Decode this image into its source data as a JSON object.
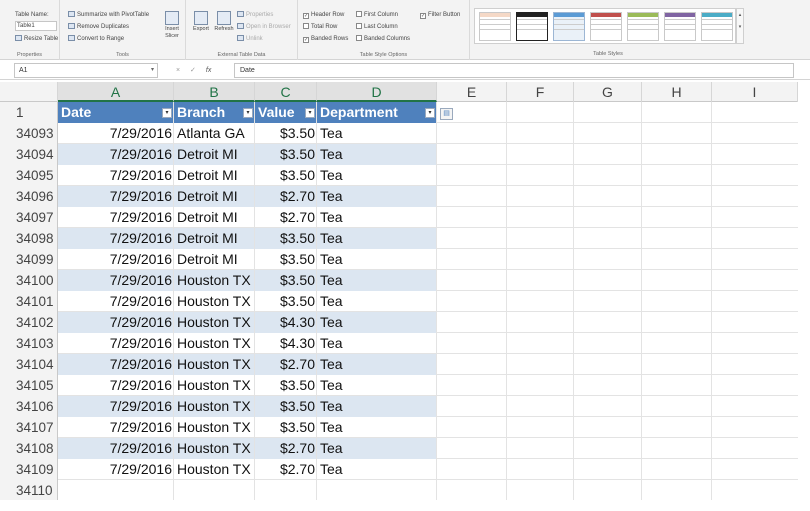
{
  "ribbon": {
    "properties": {
      "table_name_label": "Table Name:",
      "table_name_value": "Table1",
      "resize_label": "Resize Table",
      "group_label": "Properties"
    },
    "tools": {
      "summarize_label": "Summarize with PivotTable",
      "remove_duplicates_label": "Remove Duplicates",
      "convert_label": "Convert to Range",
      "insert_slicer_label": "Insert Slicer",
      "group_label": "Tools"
    },
    "external": {
      "export_label": "Export",
      "refresh_label": "Refresh",
      "properties_label": "Properties",
      "open_browser_label": "Open in Browser",
      "unlink_label": "Unlink",
      "group_label": "External Table Data"
    },
    "style_options": {
      "header_row": "Header Row",
      "total_row": "Total Row",
      "banded_rows": "Banded Rows",
      "first_column": "First Column",
      "last_column": "Last Column",
      "banded_columns": "Banded Columns",
      "filter_button": "Filter Button",
      "group_label": "Table Style Options"
    },
    "table_styles": {
      "group_label": "Table Styles",
      "swatch_colors": [
        "#f5d9c7",
        "#222222",
        "#5b9bd5",
        "#c0504d",
        "#9bbb59",
        "#8064a2",
        "#4bacc6"
      ]
    }
  },
  "formula_bar": {
    "name_box": "A1",
    "cancel_icon": "×",
    "enter_icon": "✓",
    "fx_label": "fx",
    "formula": "Date"
  },
  "columns": [
    "A",
    "B",
    "C",
    "D",
    "E",
    "F",
    "G",
    "H",
    "I"
  ],
  "table": {
    "header_row_number": "1",
    "headers": [
      "Date",
      "Branch",
      "Value",
      "Department"
    ],
    "filter_icon": "▾",
    "rows": [
      {
        "n": "34093",
        "date": "7/29/2016",
        "branch": "Atlanta GA",
        "value": "$3.50",
        "dept": "Tea"
      },
      {
        "n": "34094",
        "date": "7/29/2016",
        "branch": "Detroit MI",
        "value": "$3.50",
        "dept": "Tea"
      },
      {
        "n": "34095",
        "date": "7/29/2016",
        "branch": "Detroit MI",
        "value": "$3.50",
        "dept": "Tea"
      },
      {
        "n": "34096",
        "date": "7/29/2016",
        "branch": "Detroit MI",
        "value": "$2.70",
        "dept": "Tea"
      },
      {
        "n": "34097",
        "date": "7/29/2016",
        "branch": "Detroit MI",
        "value": "$2.70",
        "dept": "Tea"
      },
      {
        "n": "34098",
        "date": "7/29/2016",
        "branch": "Detroit MI",
        "value": "$3.50",
        "dept": "Tea"
      },
      {
        "n": "34099",
        "date": "7/29/2016",
        "branch": "Detroit MI",
        "value": "$3.50",
        "dept": "Tea"
      },
      {
        "n": "34100",
        "date": "7/29/2016",
        "branch": "Houston TX",
        "value": "$3.50",
        "dept": "Tea"
      },
      {
        "n": "34101",
        "date": "7/29/2016",
        "branch": "Houston TX",
        "value": "$3.50",
        "dept": "Tea"
      },
      {
        "n": "34102",
        "date": "7/29/2016",
        "branch": "Houston TX",
        "value": "$4.30",
        "dept": "Tea"
      },
      {
        "n": "34103",
        "date": "7/29/2016",
        "branch": "Houston TX",
        "value": "$4.30",
        "dept": "Tea"
      },
      {
        "n": "34104",
        "date": "7/29/2016",
        "branch": "Houston TX",
        "value": "$2.70",
        "dept": "Tea"
      },
      {
        "n": "34105",
        "date": "7/29/2016",
        "branch": "Houston TX",
        "value": "$3.50",
        "dept": "Tea"
      },
      {
        "n": "34106",
        "date": "7/29/2016",
        "branch": "Houston TX",
        "value": "$3.50",
        "dept": "Tea"
      },
      {
        "n": "34107",
        "date": "7/29/2016",
        "branch": "Houston TX",
        "value": "$3.50",
        "dept": "Tea"
      },
      {
        "n": "34108",
        "date": "7/29/2016",
        "branch": "Houston TX",
        "value": "$2.70",
        "dept": "Tea"
      },
      {
        "n": "34109",
        "date": "7/29/2016",
        "branch": "Houston TX",
        "value": "$2.70",
        "dept": "Tea"
      }
    ],
    "next_row_number": "34110"
  }
}
